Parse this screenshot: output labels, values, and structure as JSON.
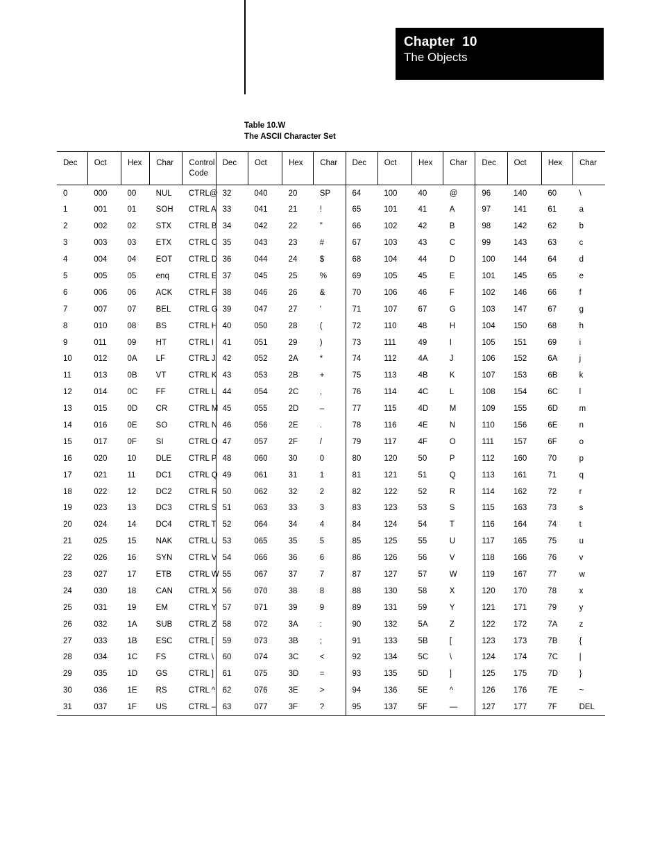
{
  "chapter": {
    "number_line": "Chapter  10",
    "subtitle": "The Objects"
  },
  "caption": {
    "line1": "Table 10.W",
    "line2": "The ASCII Character Set"
  },
  "table": {
    "headers_block1": [
      "Dec",
      "Oct",
      "Hex",
      "Char",
      "Control\nCode"
    ],
    "headers_block": [
      "Dec",
      "Oct",
      "Hex",
      "Char"
    ],
    "rows": [
      {
        "b1": [
          "0",
          "000",
          "00",
          "NUL",
          "CTRL@"
        ],
        "b2": [
          "32",
          "040",
          "20",
          "SP"
        ],
        "b3": [
          "64",
          "100",
          "40",
          "@"
        ],
        "b4": [
          "96",
          "140",
          "60",
          "\\"
        ]
      },
      {
        "b1": [
          "1",
          "001",
          "01",
          "SOH",
          "CTRL A"
        ],
        "b2": [
          "33",
          "041",
          "21",
          "!"
        ],
        "b3": [
          "65",
          "101",
          "41",
          "A"
        ],
        "b4": [
          "97",
          "141",
          "61",
          "a"
        ]
      },
      {
        "b1": [
          "2",
          "002",
          "02",
          "STX",
          "CTRL B"
        ],
        "b2": [
          "34",
          "042",
          "22",
          "\""
        ],
        "b3": [
          "66",
          "102",
          "42",
          "B"
        ],
        "b4": [
          "98",
          "142",
          "62",
          "b"
        ]
      },
      {
        "b1": [
          "3",
          "003",
          "03",
          "ETX",
          "CTRL C"
        ],
        "b2": [
          "35",
          "043",
          "23",
          "#"
        ],
        "b3": [
          "67",
          "103",
          "43",
          "C"
        ],
        "b4": [
          "99",
          "143",
          "63",
          "c"
        ]
      },
      {
        "b1": [
          "4",
          "004",
          "04",
          "EOT",
          "CTRL D"
        ],
        "b2": [
          "36",
          "044",
          "24",
          "$"
        ],
        "b3": [
          "68",
          "104",
          "44",
          "D"
        ],
        "b4": [
          "100",
          "144",
          "64",
          "d"
        ]
      },
      {
        "b1": [
          "5",
          "005",
          "05",
          "enq",
          "CTRL E"
        ],
        "b2": [
          "37",
          "045",
          "25",
          "%"
        ],
        "b3": [
          "69",
          "105",
          "45",
          "E"
        ],
        "b4": [
          "101",
          "145",
          "65",
          "e"
        ]
      },
      {
        "b1": [
          "6",
          "006",
          "06",
          "ACK",
          "CTRL F"
        ],
        "b2": [
          "38",
          "046",
          "26",
          "&"
        ],
        "b3": [
          "70",
          "106",
          "46",
          "F"
        ],
        "b4": [
          "102",
          "146",
          "66",
          "f"
        ]
      },
      {
        "b1": [
          "7",
          "007",
          "07",
          "BEL",
          "CTRL G"
        ],
        "b2": [
          "39",
          "047",
          "27",
          "'"
        ],
        "b3": [
          "71",
          "107",
          "67",
          "G"
        ],
        "b4": [
          "103",
          "147",
          "67",
          "g"
        ]
      },
      {
        "b1": [
          "8",
          "010",
          "08",
          "BS",
          "CTRL H"
        ],
        "b2": [
          "40",
          "050",
          "28",
          "("
        ],
        "b3": [
          "72",
          "110",
          "48",
          "H"
        ],
        "b4": [
          "104",
          "150",
          "68",
          "h"
        ]
      },
      {
        "b1": [
          "9",
          "011",
          "09",
          "HT",
          "CTRL I"
        ],
        "b2": [
          "41",
          "051",
          "29",
          ")"
        ],
        "b3": [
          "73",
          "111",
          "49",
          "I"
        ],
        "b4": [
          "105",
          "151",
          "69",
          "i"
        ]
      },
      {
        "b1": [
          "10",
          "012",
          "0A",
          "LF",
          "CTRL J"
        ],
        "b2": [
          "42",
          "052",
          "2A",
          "*"
        ],
        "b3": [
          "74",
          "112",
          "4A",
          "J"
        ],
        "b4": [
          "106",
          "152",
          "6A",
          "j"
        ]
      },
      {
        "b1": [
          "11",
          "013",
          "0B",
          "VT",
          "CTRL K"
        ],
        "b2": [
          "43",
          "053",
          "2B",
          "+"
        ],
        "b3": [
          "75",
          "113",
          "4B",
          "K"
        ],
        "b4": [
          "107",
          "153",
          "6B",
          "k"
        ]
      },
      {
        "b1": [
          "12",
          "014",
          "0C",
          "FF",
          "CTRL L"
        ],
        "b2": [
          "44",
          "054",
          "2C",
          ","
        ],
        "b3": [
          "76",
          "114",
          "4C",
          "L"
        ],
        "b4": [
          "108",
          "154",
          "6C",
          "l"
        ]
      },
      {
        "b1": [
          "13",
          "015",
          "0D",
          "CR",
          "CTRL M"
        ],
        "b2": [
          "45",
          "055",
          "2D",
          "–"
        ],
        "b3": [
          "77",
          "115",
          "4D",
          "M"
        ],
        "b4": [
          "109",
          "155",
          "6D",
          "m"
        ]
      },
      {
        "b1": [
          "14",
          "016",
          "0E",
          "SO",
          "CTRL N"
        ],
        "b2": [
          "46",
          "056",
          "2E",
          "."
        ],
        "b3": [
          "78",
          "116",
          "4E",
          "N"
        ],
        "b4": [
          "110",
          "156",
          "6E",
          "n"
        ]
      },
      {
        "b1": [
          "15",
          "017",
          "0F",
          "SI",
          "CTRL O"
        ],
        "b2": [
          "47",
          "057",
          "2F",
          "/"
        ],
        "b3": [
          "79",
          "117",
          "4F",
          "O"
        ],
        "b4": [
          "111",
          "157",
          "6F",
          "o"
        ]
      },
      {
        "b1": [
          "16",
          "020",
          "10",
          "DLE",
          "CTRL P"
        ],
        "b2": [
          "48",
          "060",
          "30",
          "0"
        ],
        "b3": [
          "80",
          "120",
          "50",
          "P"
        ],
        "b4": [
          "112",
          "160",
          "70",
          "p"
        ]
      },
      {
        "b1": [
          "17",
          "021",
          "11",
          "DC1",
          "CTRL Q"
        ],
        "b2": [
          "49",
          "061",
          "31",
          "1"
        ],
        "b3": [
          "81",
          "121",
          "51",
          "Q"
        ],
        "b4": [
          "113",
          "161",
          "71",
          "q"
        ]
      },
      {
        "b1": [
          "18",
          "022",
          "12",
          "DC2",
          "CTRL R"
        ],
        "b2": [
          "50",
          "062",
          "32",
          "2"
        ],
        "b3": [
          "82",
          "122",
          "52",
          "R"
        ],
        "b4": [
          "114",
          "162",
          "72",
          "r"
        ]
      },
      {
        "b1": [
          "19",
          "023",
          "13",
          "DC3",
          "CTRL S"
        ],
        "b2": [
          "51",
          "063",
          "33",
          "3"
        ],
        "b3": [
          "83",
          "123",
          "53",
          "S"
        ],
        "b4": [
          "115",
          "163",
          "73",
          "s"
        ]
      },
      {
        "b1": [
          "20",
          "024",
          "14",
          "DC4",
          "CTRL T"
        ],
        "b2": [
          "52",
          "064",
          "34",
          "4"
        ],
        "b3": [
          "84",
          "124",
          "54",
          "T"
        ],
        "b4": [
          "116",
          "164",
          "74",
          "t"
        ]
      },
      {
        "b1": [
          "21",
          "025",
          "15",
          "NAK",
          "CTRL U"
        ],
        "b2": [
          "53",
          "065",
          "35",
          "5"
        ],
        "b3": [
          "85",
          "125",
          "55",
          "U"
        ],
        "b4": [
          "117",
          "165",
          "75",
          "u"
        ]
      },
      {
        "b1": [
          "22",
          "026",
          "16",
          "SYN",
          "CTRL V"
        ],
        "b2": [
          "54",
          "066",
          "36",
          "6"
        ],
        "b3": [
          "86",
          "126",
          "56",
          "V"
        ],
        "b4": [
          "118",
          "166",
          "76",
          "v"
        ]
      },
      {
        "b1": [
          "23",
          "027",
          "17",
          "ETB",
          "CTRL W"
        ],
        "b2": [
          "55",
          "067",
          "37",
          "7"
        ],
        "b3": [
          "87",
          "127",
          "57",
          "W"
        ],
        "b4": [
          "119",
          "167",
          "77",
          "w"
        ]
      },
      {
        "b1": [
          "24",
          "030",
          "18",
          "CAN",
          "CTRL X"
        ],
        "b2": [
          "56",
          "070",
          "38",
          "8"
        ],
        "b3": [
          "88",
          "130",
          "58",
          "X"
        ],
        "b4": [
          "120",
          "170",
          "78",
          "x"
        ]
      },
      {
        "b1": [
          "25",
          "031",
          "19",
          "EM",
          "CTRL Y"
        ],
        "b2": [
          "57",
          "071",
          "39",
          "9"
        ],
        "b3": [
          "89",
          "131",
          "59",
          "Y"
        ],
        "b4": [
          "121",
          "171",
          "79",
          "y"
        ]
      },
      {
        "b1": [
          "26",
          "032",
          "1A",
          "SUB",
          "CTRL Z"
        ],
        "b2": [
          "58",
          "072",
          "3A",
          ":"
        ],
        "b3": [
          "90",
          "132",
          "5A",
          "Z"
        ],
        "b4": [
          "122",
          "172",
          "7A",
          "z"
        ]
      },
      {
        "b1": [
          "27",
          "033",
          "1B",
          "ESC",
          "CTRL ["
        ],
        "b2": [
          "59",
          "073",
          "3B",
          ";"
        ],
        "b3": [
          "91",
          "133",
          "5B",
          "["
        ],
        "b4": [
          "123",
          "173",
          "7B",
          "{"
        ]
      },
      {
        "b1": [
          "28",
          "034",
          "1C",
          "FS",
          "CTRL \\"
        ],
        "b2": [
          "60",
          "074",
          "3C",
          "<"
        ],
        "b3": [
          "92",
          "134",
          "5C",
          "\\"
        ],
        "b4": [
          "124",
          "174",
          "7C",
          "|"
        ]
      },
      {
        "b1": [
          "29",
          "035",
          "1D",
          "GS",
          "CTRL ]"
        ],
        "b2": [
          "61",
          "075",
          "3D",
          "="
        ],
        "b3": [
          "93",
          "135",
          "5D",
          "]"
        ],
        "b4": [
          "125",
          "175",
          "7D",
          "}"
        ]
      },
      {
        "b1": [
          "30",
          "036",
          "1E",
          "RS",
          "CTRL ^"
        ],
        "b2": [
          "62",
          "076",
          "3E",
          ">"
        ],
        "b3": [
          "94",
          "136",
          "5E",
          "^"
        ],
        "b4": [
          "126",
          "176",
          "7E",
          "~"
        ]
      },
      {
        "b1": [
          "31",
          "037",
          "1F",
          "US",
          "CTRL –"
        ],
        "b2": [
          "63",
          "077",
          "3F",
          "?"
        ],
        "b3": [
          "95",
          "137",
          "5F",
          "—"
        ],
        "b4": [
          "127",
          "177",
          "7F",
          "DEL"
        ]
      }
    ]
  }
}
